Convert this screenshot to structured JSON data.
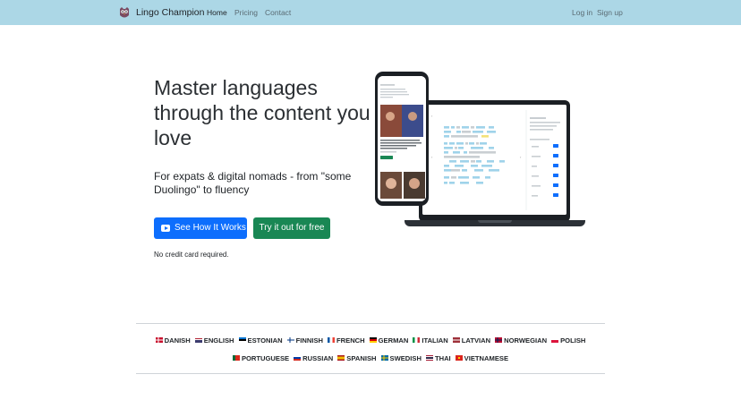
{
  "navbar": {
    "brand": "Lingo Champion",
    "links": [
      "Home",
      "Pricing",
      "Contact"
    ],
    "login": "Log in",
    "signup": "Sign up"
  },
  "hero": {
    "title": "Master languages through the content you love",
    "subtitle": "For expats & digital nomads - from \"some Duolingo\" to fluency",
    "cta_primary": "See How It Works",
    "cta_secondary": "Try it out for free",
    "note": "No credit card required."
  },
  "languages": {
    "row1": [
      {
        "name": "DANISH",
        "flag": "danish"
      },
      {
        "name": "ENGLISH",
        "flag": "english"
      },
      {
        "name": "ESTONIAN",
        "flag": "estonian"
      },
      {
        "name": "FINNISH",
        "flag": "finnish"
      },
      {
        "name": "FRENCH",
        "flag": "french"
      },
      {
        "name": "GERMAN",
        "flag": "german"
      },
      {
        "name": "ITALIAN",
        "flag": "italian"
      },
      {
        "name": "LATVIAN",
        "flag": "latvian"
      },
      {
        "name": "NORWEGIAN",
        "flag": "norwegian"
      },
      {
        "name": "POLISH",
        "flag": "polish"
      }
    ],
    "row2": [
      {
        "name": "PORTUGUESE",
        "flag": "portuguese"
      },
      {
        "name": "RUSSIAN",
        "flag": "russian"
      },
      {
        "name": "SPANISH",
        "flag": "spanish"
      },
      {
        "name": "SWEDISH",
        "flag": "swedish"
      },
      {
        "name": "THAI",
        "flag": "thai"
      },
      {
        "name": "VIETNAMESE",
        "flag": "vietnamese"
      }
    ]
  },
  "colors": {
    "navbar": "#acd7e6",
    "primary": "#0d6efd",
    "success": "#198754",
    "word_highlight": "#9fd3ea"
  },
  "icons": {
    "logo": "owl-logo-icon",
    "video": "youtube-play-icon"
  }
}
